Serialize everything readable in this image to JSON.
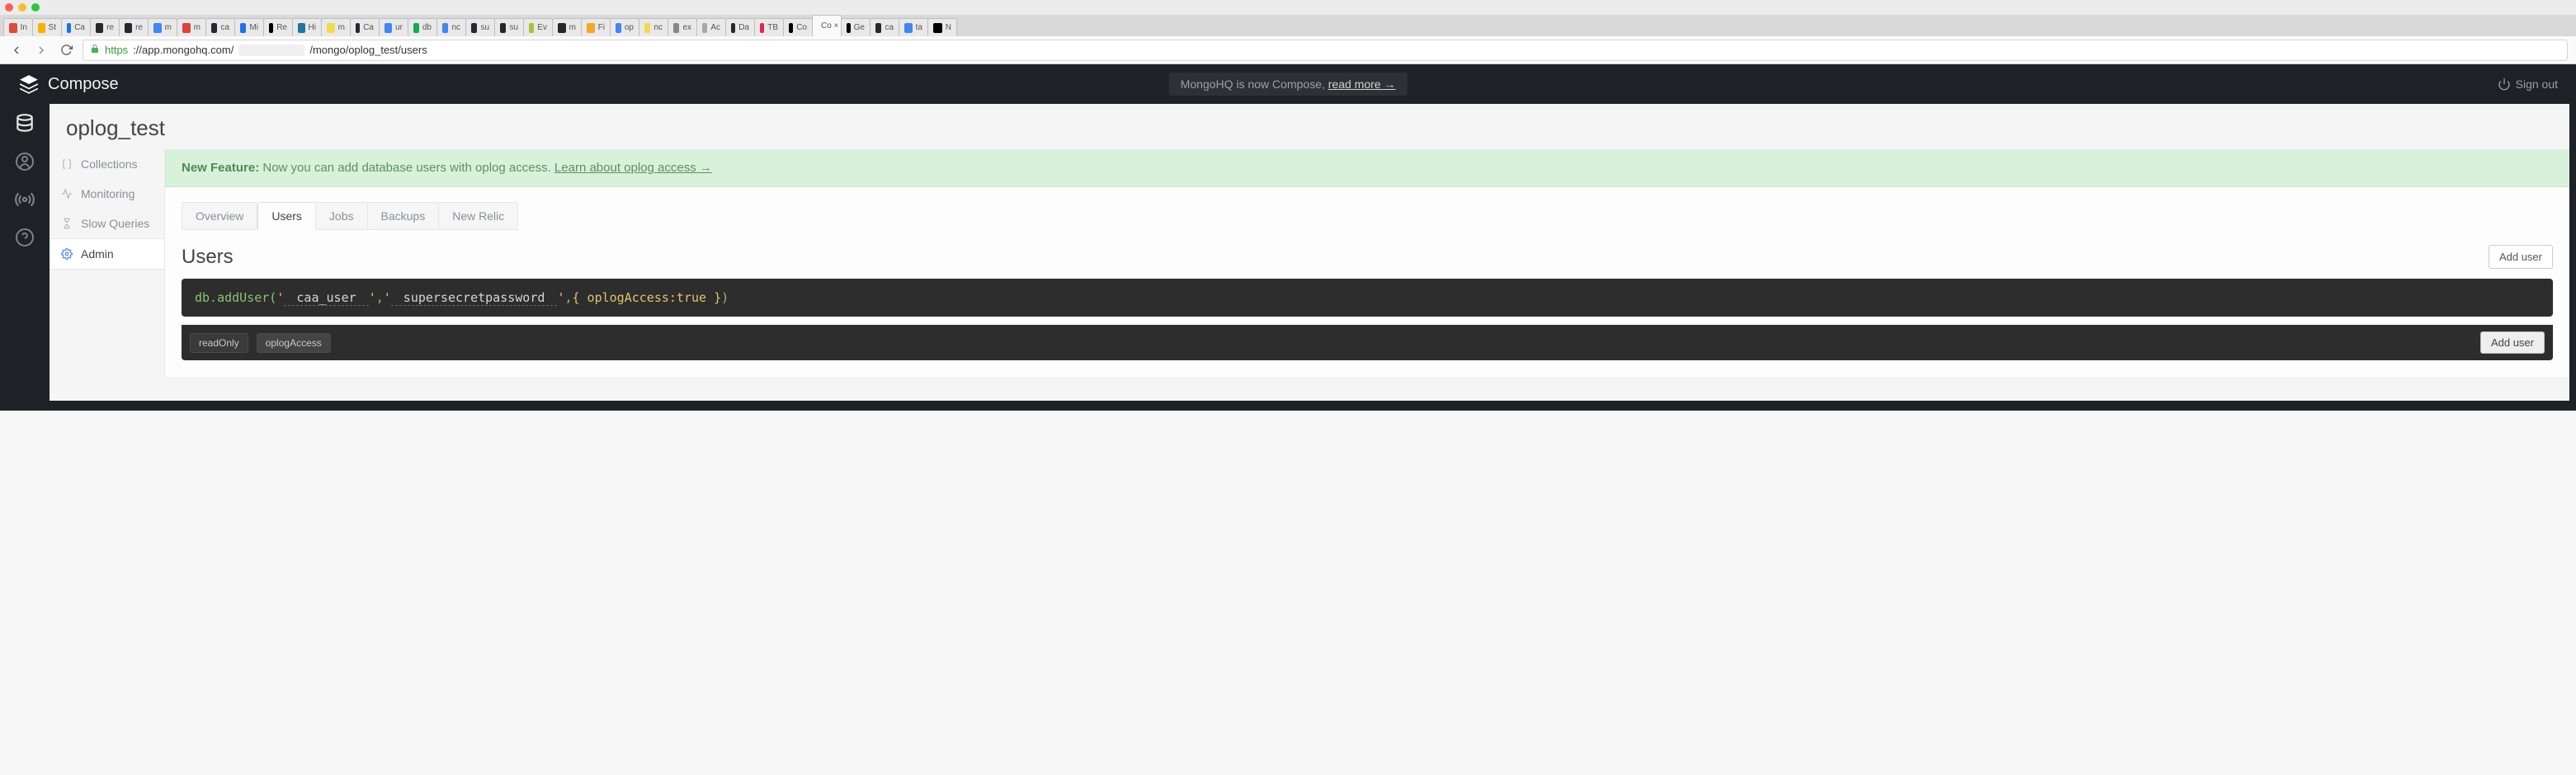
{
  "browser": {
    "url_https": "https",
    "url_host": "://app.mongohq.com/",
    "url_path": "/mongo/oplog_test/users",
    "tabs": [
      {
        "label": "In",
        "fav": "#dd4b39"
      },
      {
        "label": "St",
        "fav": "#f4b400"
      },
      {
        "label": "Ca",
        "fav": "#1a73e8"
      },
      {
        "label": "re",
        "fav": "#24292e"
      },
      {
        "label": "re",
        "fav": "#24292e"
      },
      {
        "label": "m",
        "fav": "#4285f4"
      },
      {
        "label": "m",
        "fav": "#db4437"
      },
      {
        "label": "ca",
        "fav": "#24292e"
      },
      {
        "label": "Mi",
        "fav": "#1a73e8"
      },
      {
        "label": "Re",
        "fav": "#000000"
      },
      {
        "label": "Hi",
        "fav": "#21759b"
      },
      {
        "label": "m",
        "fav": "#f0db4f"
      },
      {
        "label": "Ca",
        "fav": "#24292e"
      },
      {
        "label": "ur",
        "fav": "#4285f4"
      },
      {
        "label": "db",
        "fav": "#13aa52"
      },
      {
        "label": "nc",
        "fav": "#4285f4"
      },
      {
        "label": "su",
        "fav": "#24292e"
      },
      {
        "label": "su",
        "fav": "#24292e"
      },
      {
        "label": "Ev",
        "fav": "#a4c639"
      },
      {
        "label": "m",
        "fav": "#24292e"
      },
      {
        "label": "Fi",
        "fav": "#f5a623"
      },
      {
        "label": "op",
        "fav": "#4285f4"
      },
      {
        "label": "nc",
        "fav": "#f0db4f"
      },
      {
        "label": "ex",
        "fav": "#888888"
      },
      {
        "label": "Ac",
        "fav": "#a2aaad"
      },
      {
        "label": "Da",
        "fav": "#24292e"
      },
      {
        "label": "TB",
        "fav": "#e0245e"
      },
      {
        "label": "Co",
        "fav": "#000000"
      },
      {
        "label": "Co ×",
        "fav": "#ffffff",
        "active": true
      },
      {
        "label": "Ge",
        "fav": "#000000"
      },
      {
        "label": "ca",
        "fav": "#24292e"
      },
      {
        "label": "ta",
        "fav": "#4285f4"
      },
      {
        "label": "N",
        "fav": "#000000"
      }
    ]
  },
  "app": {
    "brand": "Compose",
    "notice_prefix": "MongoHQ is now Compose, ",
    "notice_link": "read more →",
    "signout": "Sign out"
  },
  "db": {
    "title": "oplog_test"
  },
  "sidebar": {
    "items": [
      {
        "label": "Collections"
      },
      {
        "label": "Monitoring"
      },
      {
        "label": "Slow Queries"
      },
      {
        "label": "Admin"
      }
    ]
  },
  "alert": {
    "strong": "New Feature:",
    "text": " Now you can add database users with oplog access. ",
    "link": "Learn about oplog access →"
  },
  "tabs": {
    "items": [
      {
        "label": "Overview"
      },
      {
        "label": "Users"
      },
      {
        "label": "Jobs"
      },
      {
        "label": "Backups"
      },
      {
        "label": "New Relic"
      }
    ],
    "active_index": 1
  },
  "section": {
    "heading": "Users",
    "add_user_btn": "Add user"
  },
  "code": {
    "call": "db.addUser(",
    "q1": "'",
    "user": " caa_user ",
    "q2": "'",
    "comma1": ",",
    "q3": "'",
    "pass": " supersecretpassword ",
    "q4": "'",
    "comma2": ",",
    "opts": "{ oplogAccess:true }",
    "close": ")"
  },
  "chips": {
    "readOnly": "readOnly",
    "oplogAccess": "oplogAccess",
    "add": "Add user"
  }
}
